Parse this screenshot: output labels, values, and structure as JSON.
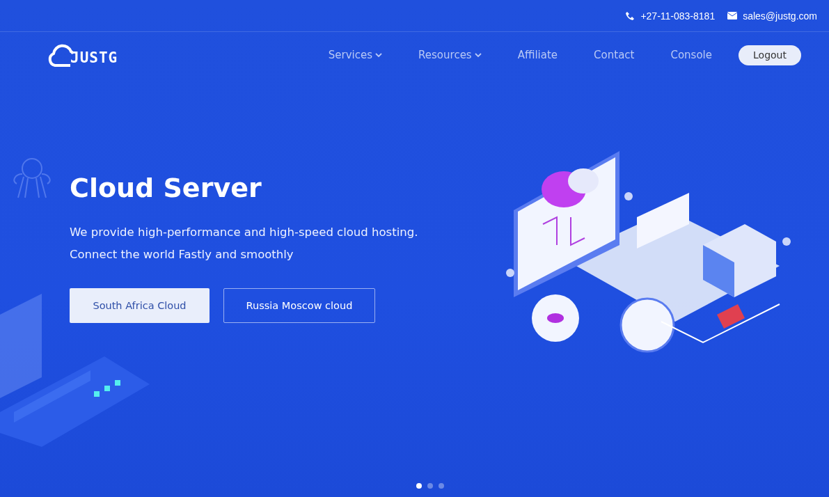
{
  "topbar": {
    "phone": "+27-11-083-8181",
    "email": "sales@justg.com"
  },
  "logo": {
    "text": "JUSTG"
  },
  "nav": [
    {
      "label": "Services",
      "dropdown": true
    },
    {
      "label": "Resources",
      "dropdown": true
    },
    {
      "label": "Affiliate",
      "dropdown": false
    },
    {
      "label": "Contact",
      "dropdown": false
    },
    {
      "label": "Console",
      "dropdown": false
    }
  ],
  "account_button": "Logout",
  "hero": {
    "title": "Cloud Server",
    "lines": [
      "We provide high-performance and high-speed cloud hosting.",
      "Connect the world Fastly and smoothly"
    ],
    "buttons": [
      {
        "label": "South Africa Cloud",
        "kind": "filled"
      },
      {
        "label": "Russia Moscow cloud",
        "kind": "outline"
      }
    ]
  },
  "carousel": [
    {
      "selected": true
    },
    {
      "selected": false
    },
    {
      "selected": false
    }
  ]
}
